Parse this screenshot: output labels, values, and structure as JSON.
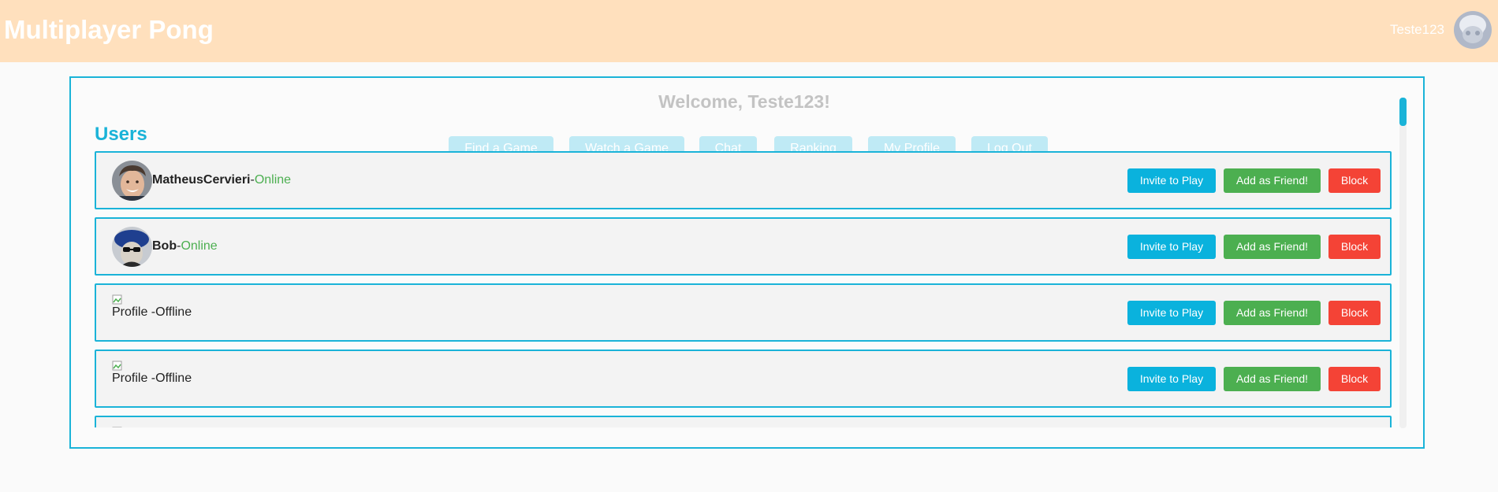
{
  "header": {
    "title": "Multiplayer Pong",
    "username": "Teste123"
  },
  "main": {
    "welcome": "Welcome, Teste123!",
    "nav": [
      "Find a Game",
      "Watch a Game",
      "Chat",
      "Ranking",
      "My Profile",
      "Log Out"
    ],
    "users_heading": "Users"
  },
  "users": [
    {
      "name": "MatheusCervieri",
      "separator": "-",
      "status": "Online"
    },
    {
      "name": "Bob",
      "separator": "-",
      "status": "Online"
    },
    {
      "name": "Profile",
      "separator": " -",
      "status": "Offline"
    },
    {
      "name": "Profile",
      "separator": " -",
      "status": "Offline"
    }
  ],
  "actions": {
    "invite": "Invite to Play",
    "friend": "Add as Friend!",
    "block": "Block"
  },
  "colors": {
    "header_bg": "#ffe0bd",
    "accent": "#1ab3d8",
    "online": "#4caf50",
    "offline": "#f44336"
  }
}
